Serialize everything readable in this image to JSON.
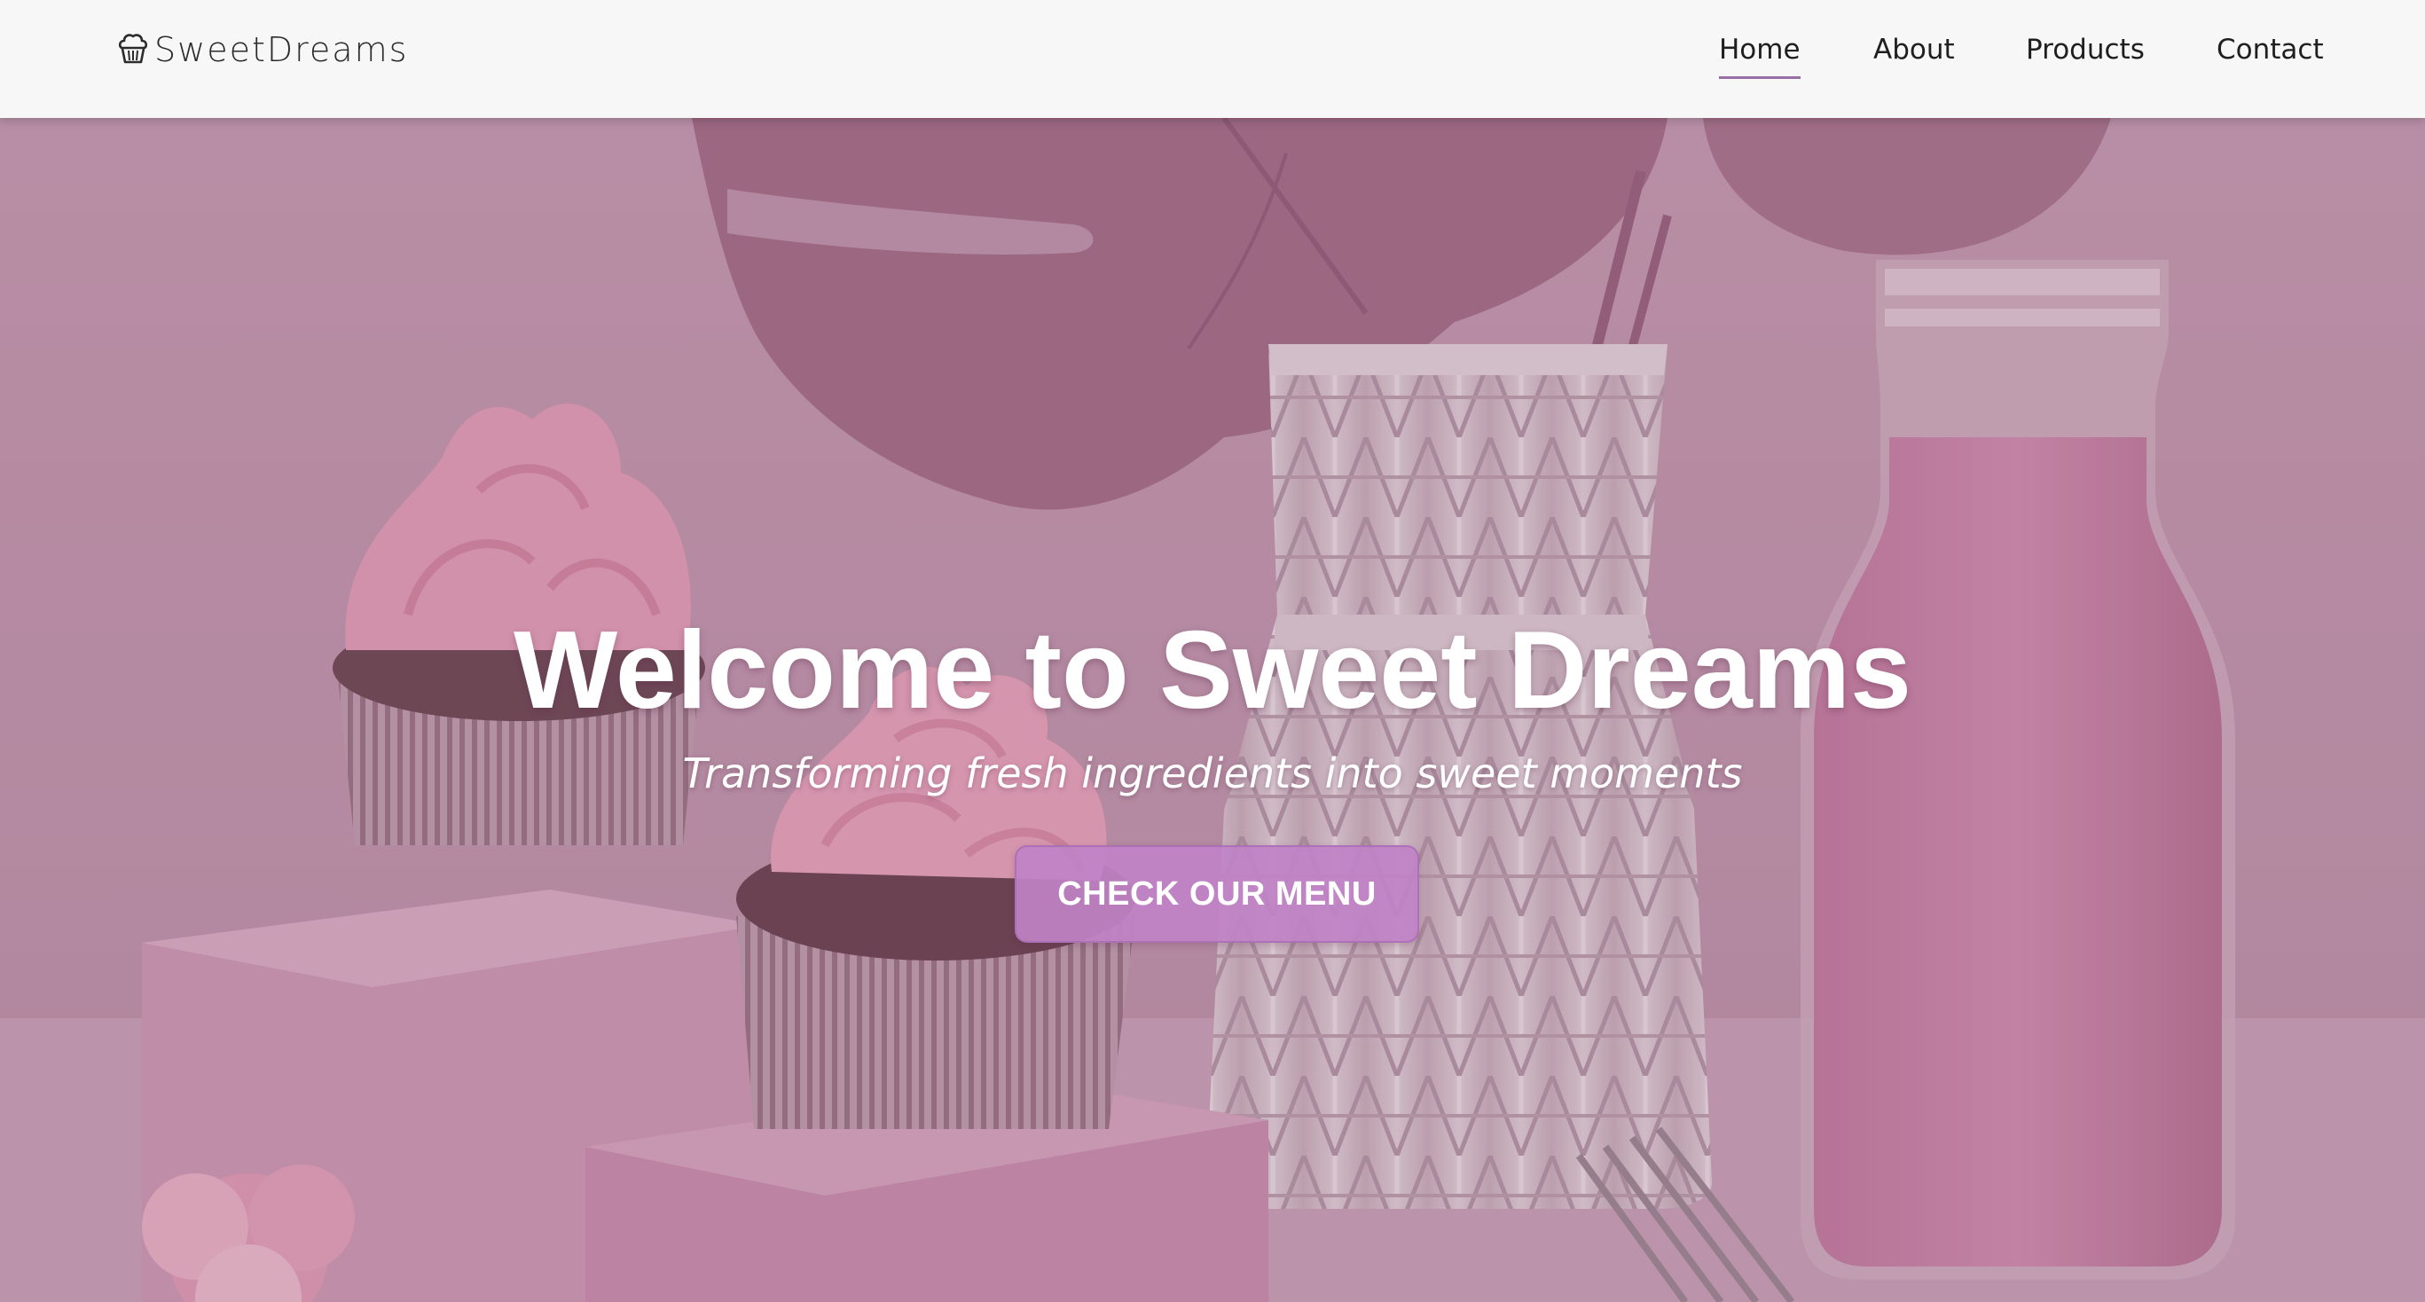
{
  "navbar": {
    "brand": {
      "icon": "cupcake-icon",
      "text": "SweetDreams"
    },
    "links": [
      {
        "label": "Home",
        "active": true
      },
      {
        "label": "About",
        "active": false
      },
      {
        "label": "Products",
        "active": false
      },
      {
        "label": "Contact",
        "active": false
      }
    ],
    "active_underline_color": "#9a6fa6"
  },
  "hero": {
    "title": "Welcome to Sweet Dreams",
    "subtitle": "Transforming fresh ingredients into sweet moments",
    "cta_label": "CHECK OUR MENU",
    "cta_color": "#c082c6",
    "background_image": "pink cupcakes, white geometric vase with pink monstera leaf, milk bottle with pink smoothie, fork"
  }
}
